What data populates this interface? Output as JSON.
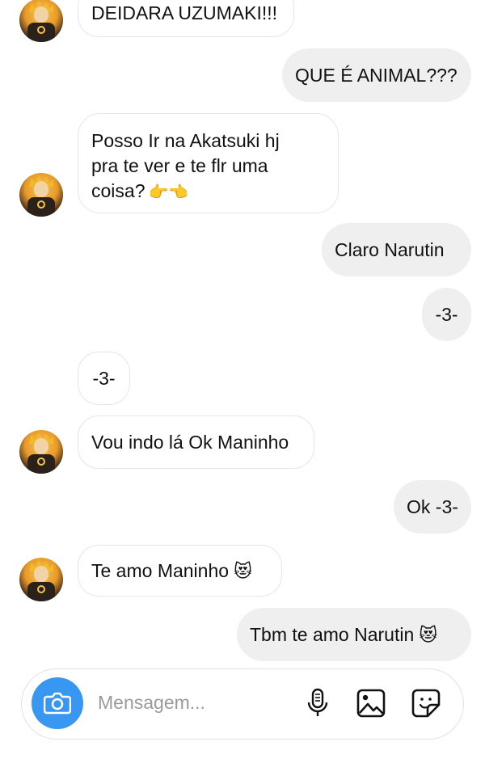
{
  "messages": [
    {
      "side": "in",
      "avatar": true,
      "text": "DEIDARA UZUMAKI!!!"
    },
    {
      "side": "out",
      "text": "QUE É ANIMAL???"
    },
    {
      "side": "in",
      "avatar": true,
      "lines": [
        "Posso Ir na Akatsuki hj",
        "pra te ver e te flr uma",
        "coisa?"
      ],
      "trailing_emoji": "👉👈"
    },
    {
      "side": "out",
      "text": "Claro Narutin"
    },
    {
      "side": "out",
      "text": "-3-"
    },
    {
      "side": "in",
      "avatar": false,
      "text": "-3-"
    },
    {
      "side": "in",
      "avatar": true,
      "text": "Vou indo lá Ok Maninho"
    },
    {
      "side": "out",
      "text": "Ok -3-"
    },
    {
      "side": "in",
      "avatar": true,
      "text": "Te amo Maninho",
      "trailing_emoji": "😻"
    },
    {
      "side": "out",
      "text": "Tbm te amo Narutin",
      "trailing_emoji": "😻"
    }
  ],
  "composer": {
    "placeholder": "Mensagem...",
    "icons": [
      "camera-icon",
      "microphone-icon",
      "gallery-icon",
      "sticker-icon"
    ]
  },
  "colors": {
    "camera_button": "#3897f0",
    "outgoing_bubble": "#efefef",
    "incoming_border": "#e6e6e6"
  }
}
